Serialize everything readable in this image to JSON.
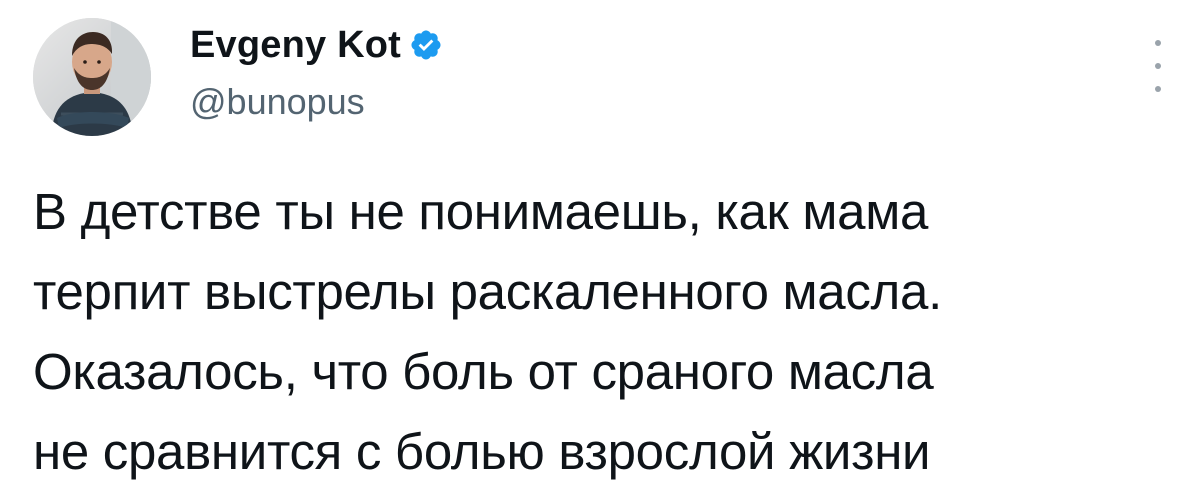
{
  "tweet": {
    "author": {
      "display_name": "Evgeny Kot",
      "handle": "@bunopus",
      "verified": true,
      "avatar_icon": "user-avatar-photo"
    },
    "body_lines": [
      "В детстве ты не понимаешь, как мама",
      "терпит выстрелы раскаленного масла.",
      "Оказалось, что боль от сраного масла",
      "не сравнится с болью взрослой жизни"
    ],
    "more_icon": "more-vertical-icon"
  },
  "colors": {
    "text_primary": "#0f1419",
    "text_secondary": "#536471",
    "verified_blue": "#1d9bf0",
    "background": "#ffffff"
  }
}
